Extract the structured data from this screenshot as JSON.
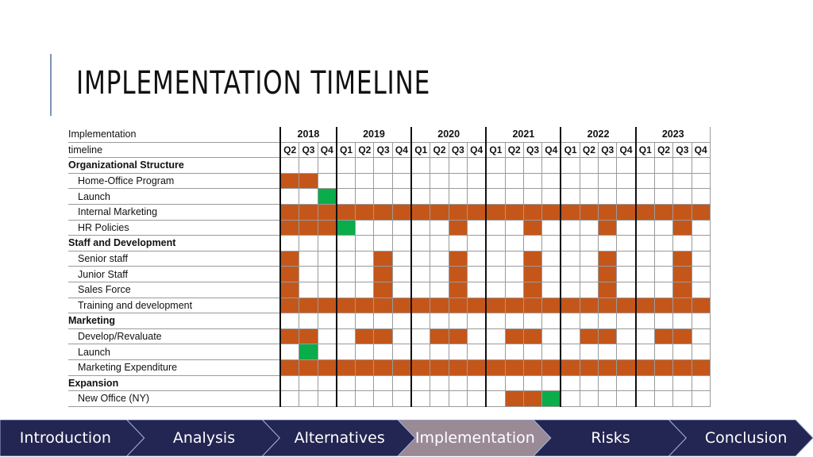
{
  "title": "IMPLEMENTATION TIMELINE",
  "table": {
    "header_label_line1": "Implementation",
    "header_label_line2": "timeline",
    "years": [
      {
        "label": "2018",
        "quarters": [
          "Q2",
          "Q3",
          "Q4"
        ]
      },
      {
        "label": "2019",
        "quarters": [
          "Q1",
          "Q2",
          "Q3",
          "Q4"
        ]
      },
      {
        "label": "2020",
        "quarters": [
          "Q1",
          "Q2",
          "Q3",
          "Q4"
        ]
      },
      {
        "label": "2021",
        "quarters": [
          "Q1",
          "Q2",
          "Q3",
          "Q4"
        ]
      },
      {
        "label": "2022",
        "quarters": [
          "Q1",
          "Q2",
          "Q3",
          "Q4"
        ]
      },
      {
        "label": "2023",
        "quarters": [
          "Q1",
          "Q2",
          "Q3",
          "Q4"
        ]
      }
    ],
    "legend_colors": {
      "active": "#c5561a",
      "milestone": "#0aad4a"
    },
    "rows": [
      {
        "label": "Organizational Structure",
        "section": true,
        "active": [],
        "milestone": []
      },
      {
        "label": "Home-Office Program",
        "section": false,
        "active": [
          0,
          1
        ],
        "milestone": []
      },
      {
        "label": "Launch",
        "section": false,
        "active": [],
        "milestone": [
          2
        ]
      },
      {
        "label": "Internal Marketing",
        "section": false,
        "active": [
          0,
          1,
          2,
          3,
          4,
          5,
          6,
          7,
          8,
          9,
          10,
          11,
          12,
          13,
          14,
          15,
          16,
          17,
          18,
          19,
          20,
          21,
          22
        ],
        "milestone": []
      },
      {
        "label": "HR Policies",
        "section": false,
        "active": [
          0,
          1,
          2,
          9,
          13,
          17,
          21
        ],
        "milestone": [
          3
        ]
      },
      {
        "label": "Staff and Development",
        "section": true,
        "active": [],
        "milestone": []
      },
      {
        "label": "Senior staff",
        "section": false,
        "active": [
          0,
          5,
          9,
          13,
          17,
          21
        ],
        "milestone": []
      },
      {
        "label": "Junior Staff",
        "section": false,
        "active": [
          0,
          5,
          9,
          13,
          17,
          21
        ],
        "milestone": []
      },
      {
        "label": "Sales Force",
        "section": false,
        "active": [
          0,
          5,
          9,
          13,
          17,
          21
        ],
        "milestone": []
      },
      {
        "label": "Training and development",
        "section": false,
        "active": [
          0,
          1,
          2,
          3,
          4,
          5,
          6,
          7,
          8,
          9,
          10,
          11,
          12,
          13,
          14,
          15,
          16,
          17,
          18,
          19,
          20,
          21,
          22
        ],
        "milestone": []
      },
      {
        "label": "Marketing",
        "section": true,
        "active": [],
        "milestone": []
      },
      {
        "label": "Develop/Revaluate",
        "section": false,
        "active": [
          0,
          1,
          4,
          5,
          8,
          9,
          12,
          13,
          16,
          17,
          20,
          21
        ],
        "milestone": []
      },
      {
        "label": "Launch",
        "section": false,
        "active": [],
        "milestone": [
          1
        ]
      },
      {
        "label": "Marketing Expenditure",
        "section": false,
        "active": [
          0,
          1,
          2,
          3,
          4,
          5,
          6,
          7,
          8,
          9,
          10,
          11,
          12,
          13,
          14,
          15,
          16,
          17,
          18,
          19,
          20,
          21,
          22
        ],
        "milestone": []
      },
      {
        "label": "Expansion",
        "section": true,
        "active": [],
        "milestone": []
      },
      {
        "label": "New Office (NY)",
        "section": false,
        "active": [
          12,
          13
        ],
        "milestone": [
          14
        ]
      }
    ]
  },
  "nav": {
    "items": [
      {
        "label": "Introduction",
        "active": false
      },
      {
        "label": "Analysis",
        "active": false
      },
      {
        "label": "Alternatives",
        "active": false
      },
      {
        "label": "Implementation",
        "active": true
      },
      {
        "label": "Risks",
        "active": false
      },
      {
        "label": "Conclusion",
        "active": false
      }
    ],
    "colors": {
      "normal": "#232552",
      "active": "#9a8a96",
      "border": "#9fb0d8"
    }
  }
}
